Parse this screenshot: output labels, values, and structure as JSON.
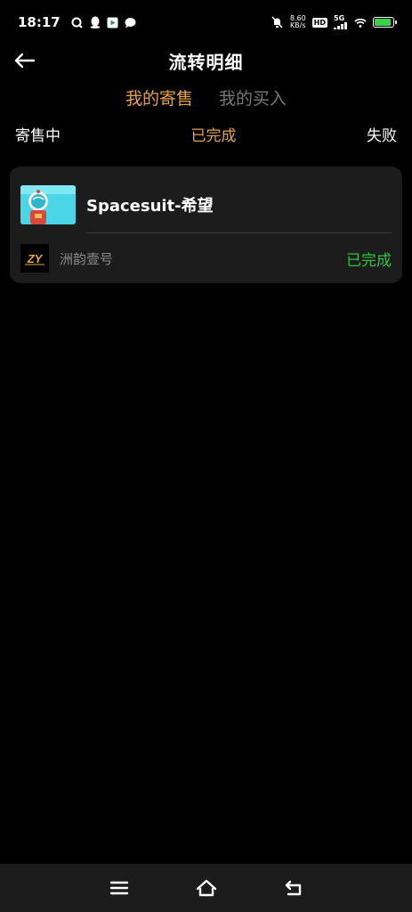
{
  "status_bar": {
    "time": "18:17",
    "net_speed_value": "8.60",
    "net_speed_unit": "KB/s",
    "hd_label": "HD",
    "network": "5G",
    "battery_level": 0.9,
    "battery_color": "#3bd14a"
  },
  "header": {
    "title": "流转明细",
    "back_icon": "arrow-left-icon"
  },
  "tabs": [
    {
      "label": "我的寄售",
      "active": true
    },
    {
      "label": "我的买入",
      "active": false
    }
  ],
  "filters": [
    {
      "label": "寄售中",
      "active": false
    },
    {
      "label": "已完成",
      "active": true
    },
    {
      "label": "失败",
      "active": false
    }
  ],
  "records": [
    {
      "item_name": "Spacesuit-希望",
      "brand_name": "洲韵壹号",
      "brand_logo_text": "ZY",
      "status": "已完成",
      "status_color": "#2ec43a"
    }
  ],
  "colors": {
    "accent": "#e7a24a",
    "inactive_tab": "#777777",
    "card_bg": "#1c1c1c"
  },
  "nav_bar": {
    "icons": [
      "menu-icon",
      "home-icon",
      "back-icon"
    ]
  }
}
